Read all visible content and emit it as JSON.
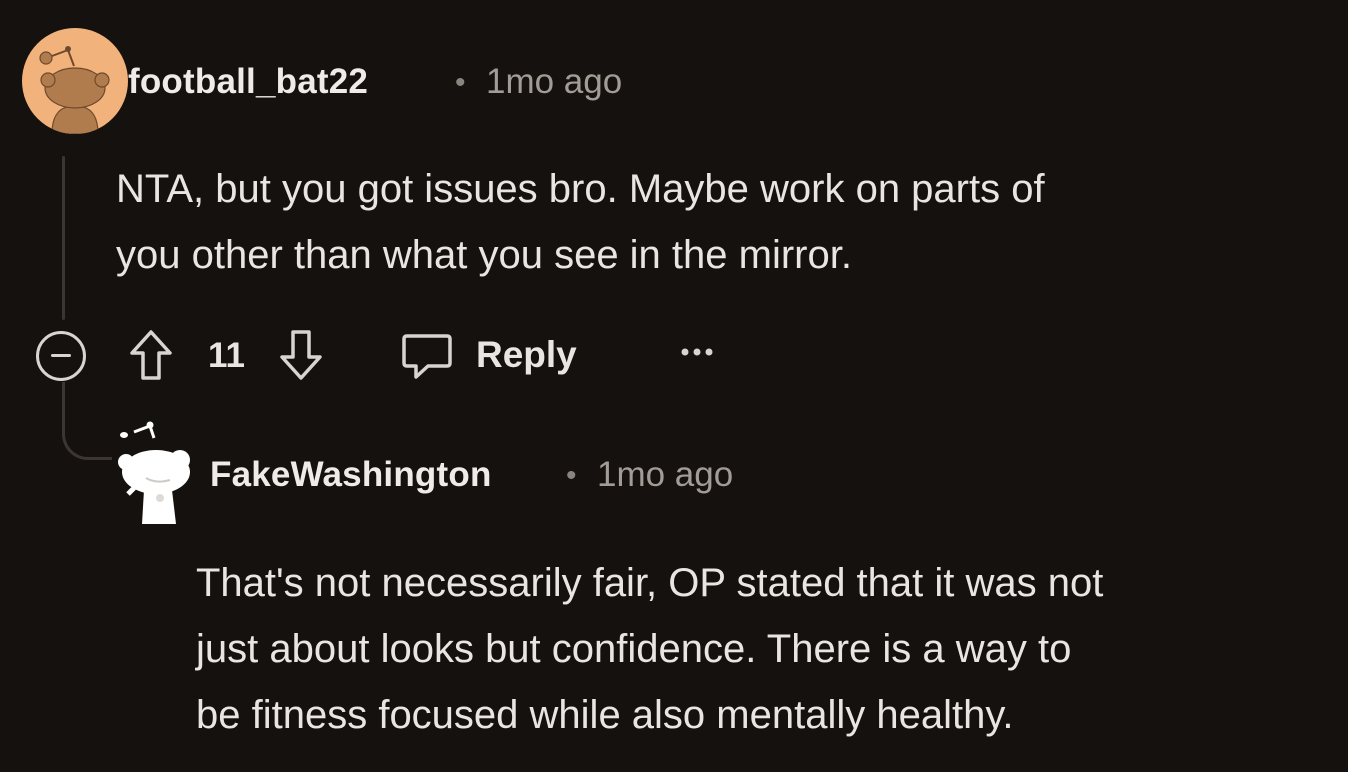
{
  "comments": [
    {
      "username": "football_bat22",
      "timestamp": "1mo ago",
      "separator": "•",
      "lines": [
        "NTA, but you got issues bro. Maybe work on parts of",
        "you other than what you see in the mirror."
      ],
      "score": "11",
      "reply_label": "Reply",
      "avatar_color": "#f2b27c"
    },
    {
      "username": "FakeWashington",
      "timestamp": "1mo ago",
      "separator": "•",
      "lines": [
        "That's not necessarily fair, OP stated that it was not",
        "just about looks but confidence. There is a way to",
        "be fitness focused while also mentally healthy."
      ]
    }
  ],
  "colors": {
    "background": "#15110e",
    "thread_line": "#3b3632"
  },
  "icons": {
    "collapse": "minus-circle-icon",
    "upvote": "arrow-up-outline-icon",
    "downvote": "arrow-down-outline-icon",
    "reply": "speech-bubble-icon",
    "more": "ellipsis-icon"
  }
}
